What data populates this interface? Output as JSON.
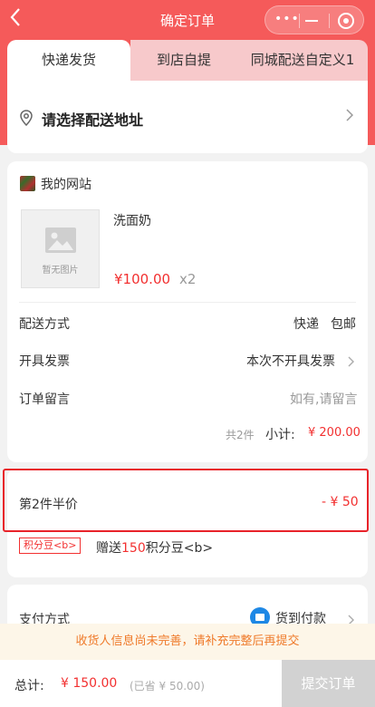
{
  "header": {
    "title": "确定订单",
    "back_icon": "chevron-left-icon",
    "capsule_icons": [
      "more-dots-icon",
      "minimize-icon",
      "close-target-icon"
    ],
    "accent_color": "#f55a5a"
  },
  "tabs": [
    "快递发货",
    "到店自提",
    "同城配送自定义1"
  ],
  "address": {
    "placeholder": "请选择配送地址",
    "icon": "location-pin-icon"
  },
  "shop": {
    "name": "我的网站",
    "product": {
      "name": "洗面奶",
      "image_placeholder": "暂无图片",
      "price": "¥100.00",
      "quantity": "x2"
    },
    "rows": {
      "delivery": {
        "label": "配送方式",
        "value": "快递",
        "value2": "包邮"
      },
      "invoice": {
        "label": "开具发票",
        "value": "本次不开具发票"
      },
      "remark": {
        "label": "订单留言",
        "placeholder": "如有,请留言"
      }
    },
    "count": "共2件",
    "subtotal_label": "小计:",
    "subtotal": "¥ 200.00"
  },
  "promotion": {
    "label": "第2件半价",
    "value": "- ¥ 50",
    "tag": "积分豆<b>",
    "gift_prefix": "赠送",
    "gift_amount": "150",
    "gift_suffix": "积分豆<b>"
  },
  "payment": {
    "label": "支付方式",
    "value": "货到付款"
  },
  "notice": "收货人信息尚未完善，请补充完整后再提交",
  "footer": {
    "total_label": "总计:",
    "total": "¥ 150.00",
    "saved": "(已省 ¥ 50.00)",
    "submit": "提交订单"
  }
}
